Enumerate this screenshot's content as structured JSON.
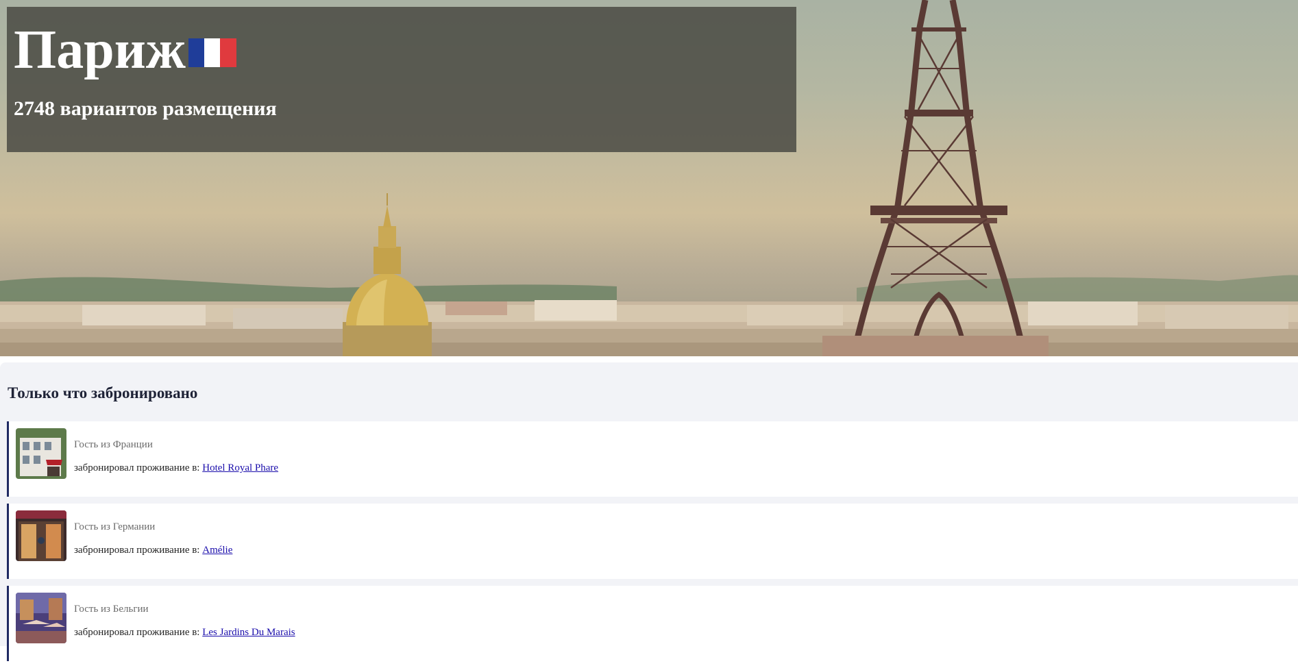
{
  "hero": {
    "title": "Париж",
    "flag_colors": [
      "#1f3d99",
      "#ffffff",
      "#e03a3e"
    ],
    "subtitle": "2748 вариантов размещения"
  },
  "bookings": {
    "heading": "Только что забронировано",
    "items": [
      {
        "guest": "Гость из Франции",
        "prefix": "забронировал проживание в:",
        "hotel": "Hotel Royal Phare"
      },
      {
        "guest": "Гость из Германии",
        "prefix": "забронировал проживание в:",
        "hotel": "Amélie"
      },
      {
        "guest": "Гость из Бельгии",
        "prefix": "забронировал проживание в:",
        "hotel": "Les Jardins Du Marais"
      }
    ]
  },
  "colors": {
    "accent_border": "#1f2a63",
    "link": "#1a0dab",
    "section_bg": "#f2f3f7"
  }
}
